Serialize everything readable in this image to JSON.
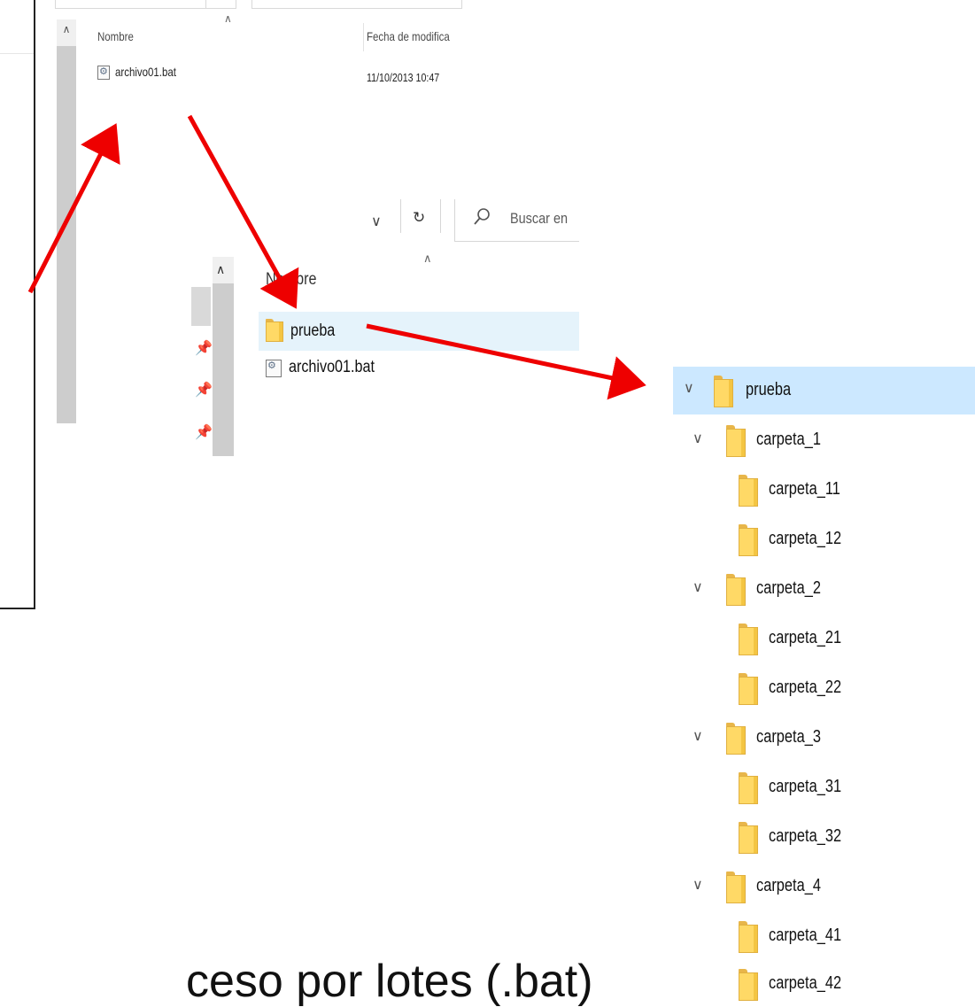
{
  "window1": {
    "header_name": "Nombre",
    "header_date": "Fecha de modifica",
    "file_name": "archivo01.bat",
    "file_date": "11/10/2013 10:47",
    "file_icon": "batch-file-icon"
  },
  "window2": {
    "refresh_icon": "↻",
    "dropdown_icon": "chevron-down-icon",
    "search_icon": "search-icon",
    "search_placeholder": "Buscar en",
    "header_name": "Nombre",
    "rows": [
      {
        "name": "prueba",
        "icon": "folder-icon",
        "selected": true
      },
      {
        "name": "archivo01.bat",
        "icon": "batch-file-icon",
        "selected": false
      }
    ]
  },
  "tree": {
    "root": "prueba",
    "items": [
      {
        "label": "carpeta_1"
      },
      {
        "label": "carpeta_11"
      },
      {
        "label": "carpeta_12"
      },
      {
        "label": "carpeta_2"
      },
      {
        "label": "carpeta_21"
      },
      {
        "label": "carpeta_22"
      },
      {
        "label": "carpeta_3"
      },
      {
        "label": "carpeta_31"
      },
      {
        "label": "carpeta_32"
      },
      {
        "label": "carpeta_4"
      },
      {
        "label": "carpeta_41"
      },
      {
        "label": "carpeta_42"
      }
    ]
  },
  "caption": "ceso por lotes (.bat)",
  "colors": {
    "arrow": "#ee0000",
    "selection_light": "#e5f3fb",
    "selection_tree": "#cce8ff",
    "folder": "#ffd966"
  }
}
